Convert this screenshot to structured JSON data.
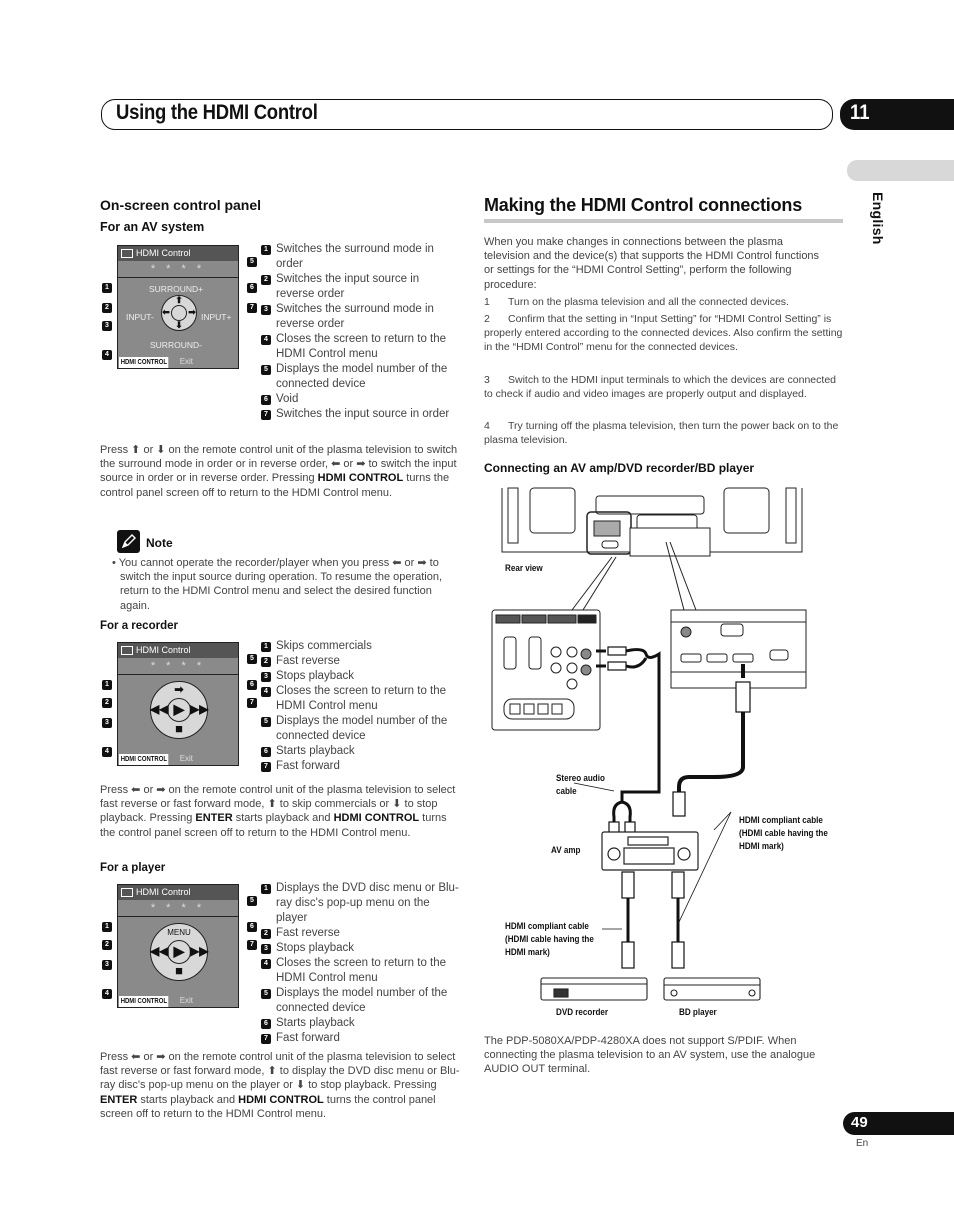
{
  "header": {
    "title": "Using the HDMI Control",
    "chapter_number": "11",
    "language_tab": "English"
  },
  "left": {
    "section_title": "On-screen control panel",
    "av_system": {
      "heading": "For an AV system",
      "panel": {
        "title": "HDMI Control",
        "stars": "* * * *",
        "labels": {
          "top": "SURROUND+",
          "bottom": "SURROUND-",
          "left": "INPUT-",
          "right": "INPUT+"
        },
        "footer_button": "HDMI CONTROL",
        "footer_text": "Exit"
      },
      "callouts": [
        {
          "n": "1",
          "text": "Switches the surround mode in order"
        },
        {
          "n": "2",
          "text": "Switches the input source in reverse order"
        },
        {
          "n": "3",
          "text": "Switches the surround mode in reverse order"
        },
        {
          "n": "4",
          "text": "Closes the screen to return to the HDMI Control menu"
        },
        {
          "n": "5",
          "text": "Displays the model number of the connected device"
        },
        {
          "n": "6",
          "text": "Void"
        },
        {
          "n": "7",
          "text": "Switches the input source in order"
        }
      ],
      "paragraph_html": "Press ⬆ or ⬇ on the remote control unit of the plasma television to switch the surround mode in order or in reverse order, ⬅ or ➡ to switch the input source in order or in reverse order. Pressing <b>HDMI CONTROL</b> turns the control panel screen off to return to the HDMI Control menu."
    },
    "note": {
      "title": "Note",
      "bullet": "You cannot operate the recorder/player when you press ⬅ or ➡ to switch the input source during operation. To resume the operation, return to the HDMI Control menu and select the desired function again."
    },
    "recorder": {
      "heading": "For a recorder",
      "panel": {
        "title": "HDMI Control",
        "stars": "* * * *",
        "footer_button": "HDMI CONTROL",
        "footer_text": "Exit"
      },
      "callouts": [
        {
          "n": "1",
          "text": "Skips commercials"
        },
        {
          "n": "2",
          "text": "Fast reverse"
        },
        {
          "n": "3",
          "text": "Stops playback"
        },
        {
          "n": "4",
          "text": "Closes the screen to return to the HDMI Control menu"
        },
        {
          "n": "5",
          "text": "Displays the model number of the connected device"
        },
        {
          "n": "6",
          "text": "Starts playback"
        },
        {
          "n": "7",
          "text": "Fast forward"
        }
      ],
      "paragraph_html": "Press ⬅ or ➡ on the remote control unit of the plasma television to select fast reverse or fast forward mode, ⬆ to skip commercials or ⬇ to stop playback. Pressing <b>ENTER</b> starts playback and <b>HDMI CONTROL</b> turns the control panel screen off to return to the HDMI Control menu."
    },
    "player": {
      "heading": "For a player",
      "panel": {
        "title": "HDMI Control",
        "stars": "* * * *",
        "menu_label": "MENU",
        "footer_button": "HDMI CONTROL",
        "footer_text": "Exit"
      },
      "callouts": [
        {
          "n": "1",
          "text": "Displays the DVD disc menu or Blu-ray disc's pop-up menu on the player"
        },
        {
          "n": "2",
          "text": "Fast reverse"
        },
        {
          "n": "3",
          "text": "Stops playback"
        },
        {
          "n": "4",
          "text": "Closes the screen to return to the HDMI Control menu"
        },
        {
          "n": "5",
          "text": "Displays the model number of the connected device"
        },
        {
          "n": "6",
          "text": "Starts playback"
        },
        {
          "n": "7",
          "text": "Fast forward"
        }
      ],
      "paragraph_html": "Press ⬅ or ➡ on the remote control unit of the plasma television to select fast reverse or fast forward mode, ⬆ to display the DVD disc menu or Blu-ray disc's pop-up menu on the player or ⬇ to stop playback. Pressing <b>ENTER</b> starts playback and <b>HDMI CONTROL</b> turns the control panel screen off to return to the HDMI Control menu."
    }
  },
  "right": {
    "section_title": "Making the HDMI Control connections",
    "intro": "When you make changes in connections between the plasma television and the device(s) that supports the HDMI Control functions or settings for the “HDMI Control Setting”, perform the following procedure:",
    "steps": [
      {
        "n": "1",
        "text": "Turn on the plasma television and all the connected devices."
      },
      {
        "n": "2",
        "text": "Confirm that the setting in “Input Setting” for “HDMI Control Setting” is properly entered according to the connected devices. Also confirm the setting in the “HDMI Control” menu for the connected devices."
      },
      {
        "n": "3",
        "text": "Switch to the HDMI input terminals to which the devices are connected to check if audio and video images are properly output and displayed."
      },
      {
        "n": "4",
        "text": "Try turning off the plasma television, then turn the power back on to the plasma television."
      }
    ],
    "diagram": {
      "heading": "Connecting an AV amp/DVD recorder/BD player",
      "rear_view": "Rear view",
      "stereo_cable": "Stereo audio cable",
      "av_amp": "AV amp",
      "hdmi_cable_right": "HDMI compliant cable (HDMI cable having the HDMI mark)",
      "hdmi_cable_left": "HDMI compliant cable (HDMI cable having the HDMI mark)",
      "dvd_recorder": "DVD recorder",
      "bd_player": "BD player"
    },
    "footer_note": "The PDP-5080XA/PDP-4280XA does not support S/PDIF. When connecting the plasma television to an AV system, use the analogue AUDIO OUT terminal."
  },
  "footer": {
    "page_number": "49",
    "language_code": "En"
  }
}
